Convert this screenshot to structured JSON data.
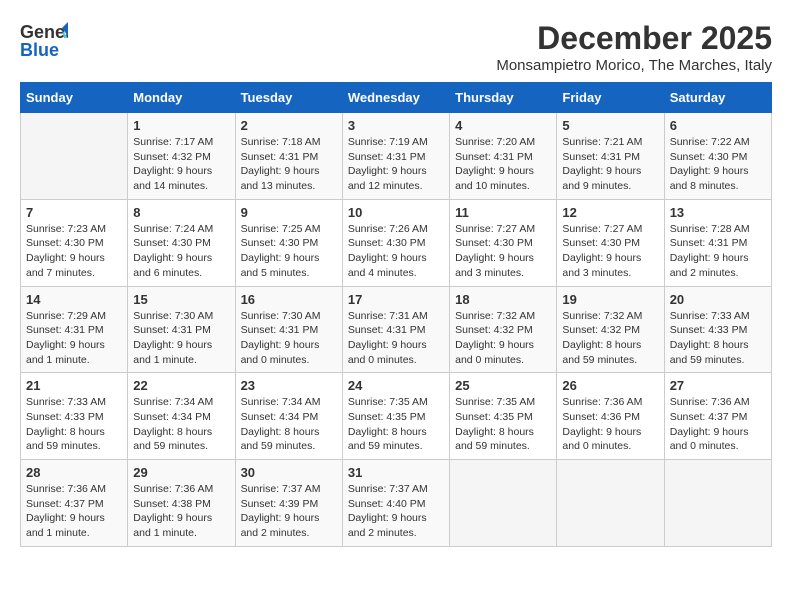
{
  "header": {
    "logo_general": "General",
    "logo_blue": "Blue",
    "month_title": "December 2025",
    "subtitle": "Monsampietro Morico, The Marches, Italy"
  },
  "days_of_week": [
    "Sunday",
    "Monday",
    "Tuesday",
    "Wednesday",
    "Thursday",
    "Friday",
    "Saturday"
  ],
  "weeks": [
    [
      {
        "day": "",
        "info": ""
      },
      {
        "day": "1",
        "info": "Sunrise: 7:17 AM\nSunset: 4:32 PM\nDaylight: 9 hours\nand 14 minutes."
      },
      {
        "day": "2",
        "info": "Sunrise: 7:18 AM\nSunset: 4:31 PM\nDaylight: 9 hours\nand 13 minutes."
      },
      {
        "day": "3",
        "info": "Sunrise: 7:19 AM\nSunset: 4:31 PM\nDaylight: 9 hours\nand 12 minutes."
      },
      {
        "day": "4",
        "info": "Sunrise: 7:20 AM\nSunset: 4:31 PM\nDaylight: 9 hours\nand 10 minutes."
      },
      {
        "day": "5",
        "info": "Sunrise: 7:21 AM\nSunset: 4:31 PM\nDaylight: 9 hours\nand 9 minutes."
      },
      {
        "day": "6",
        "info": "Sunrise: 7:22 AM\nSunset: 4:30 PM\nDaylight: 9 hours\nand 8 minutes."
      }
    ],
    [
      {
        "day": "7",
        "info": "Sunrise: 7:23 AM\nSunset: 4:30 PM\nDaylight: 9 hours\nand 7 minutes."
      },
      {
        "day": "8",
        "info": "Sunrise: 7:24 AM\nSunset: 4:30 PM\nDaylight: 9 hours\nand 6 minutes."
      },
      {
        "day": "9",
        "info": "Sunrise: 7:25 AM\nSunset: 4:30 PM\nDaylight: 9 hours\nand 5 minutes."
      },
      {
        "day": "10",
        "info": "Sunrise: 7:26 AM\nSunset: 4:30 PM\nDaylight: 9 hours\nand 4 minutes."
      },
      {
        "day": "11",
        "info": "Sunrise: 7:27 AM\nSunset: 4:30 PM\nDaylight: 9 hours\nand 3 minutes."
      },
      {
        "day": "12",
        "info": "Sunrise: 7:27 AM\nSunset: 4:30 PM\nDaylight: 9 hours\nand 3 minutes."
      },
      {
        "day": "13",
        "info": "Sunrise: 7:28 AM\nSunset: 4:31 PM\nDaylight: 9 hours\nand 2 minutes."
      }
    ],
    [
      {
        "day": "14",
        "info": "Sunrise: 7:29 AM\nSunset: 4:31 PM\nDaylight: 9 hours\nand 1 minute."
      },
      {
        "day": "15",
        "info": "Sunrise: 7:30 AM\nSunset: 4:31 PM\nDaylight: 9 hours\nand 1 minute."
      },
      {
        "day": "16",
        "info": "Sunrise: 7:30 AM\nSunset: 4:31 PM\nDaylight: 9 hours\nand 0 minutes."
      },
      {
        "day": "17",
        "info": "Sunrise: 7:31 AM\nSunset: 4:31 PM\nDaylight: 9 hours\nand 0 minutes."
      },
      {
        "day": "18",
        "info": "Sunrise: 7:32 AM\nSunset: 4:32 PM\nDaylight: 9 hours\nand 0 minutes."
      },
      {
        "day": "19",
        "info": "Sunrise: 7:32 AM\nSunset: 4:32 PM\nDaylight: 8 hours\nand 59 minutes."
      },
      {
        "day": "20",
        "info": "Sunrise: 7:33 AM\nSunset: 4:33 PM\nDaylight: 8 hours\nand 59 minutes."
      }
    ],
    [
      {
        "day": "21",
        "info": "Sunrise: 7:33 AM\nSunset: 4:33 PM\nDaylight: 8 hours\nand 59 minutes."
      },
      {
        "day": "22",
        "info": "Sunrise: 7:34 AM\nSunset: 4:34 PM\nDaylight: 8 hours\nand 59 minutes."
      },
      {
        "day": "23",
        "info": "Sunrise: 7:34 AM\nSunset: 4:34 PM\nDaylight: 8 hours\nand 59 minutes."
      },
      {
        "day": "24",
        "info": "Sunrise: 7:35 AM\nSunset: 4:35 PM\nDaylight: 8 hours\nand 59 minutes."
      },
      {
        "day": "25",
        "info": "Sunrise: 7:35 AM\nSunset: 4:35 PM\nDaylight: 8 hours\nand 59 minutes."
      },
      {
        "day": "26",
        "info": "Sunrise: 7:36 AM\nSunset: 4:36 PM\nDaylight: 9 hours\nand 0 minutes."
      },
      {
        "day": "27",
        "info": "Sunrise: 7:36 AM\nSunset: 4:37 PM\nDaylight: 9 hours\nand 0 minutes."
      }
    ],
    [
      {
        "day": "28",
        "info": "Sunrise: 7:36 AM\nSunset: 4:37 PM\nDaylight: 9 hours\nand 1 minute."
      },
      {
        "day": "29",
        "info": "Sunrise: 7:36 AM\nSunset: 4:38 PM\nDaylight: 9 hours\nand 1 minute."
      },
      {
        "day": "30",
        "info": "Sunrise: 7:37 AM\nSunset: 4:39 PM\nDaylight: 9 hours\nand 2 minutes."
      },
      {
        "day": "31",
        "info": "Sunrise: 7:37 AM\nSunset: 4:40 PM\nDaylight: 9 hours\nand 2 minutes."
      },
      {
        "day": "",
        "info": ""
      },
      {
        "day": "",
        "info": ""
      },
      {
        "day": "",
        "info": ""
      }
    ]
  ]
}
